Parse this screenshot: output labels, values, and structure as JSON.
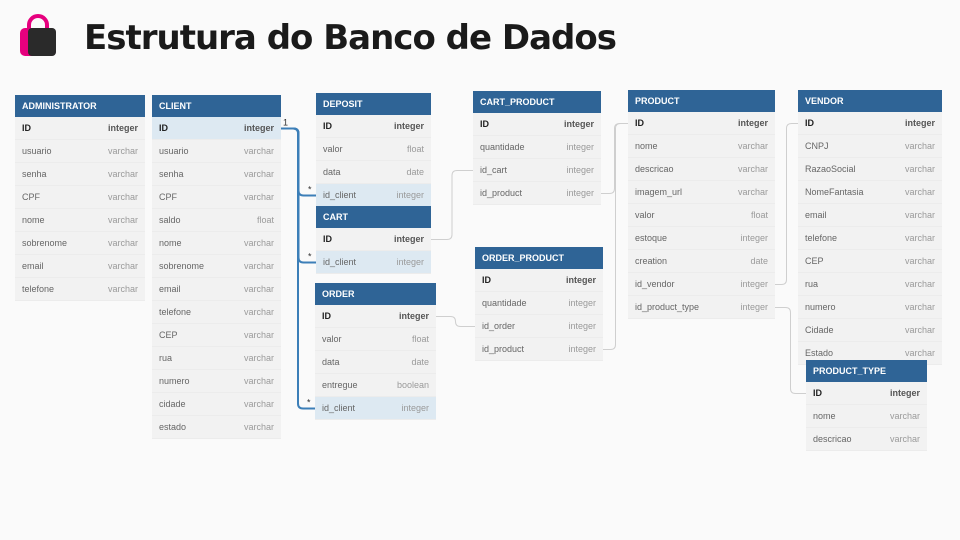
{
  "title": "Estrutura do Banco de Dados",
  "colors": {
    "header": "#2f6496",
    "highlight": "#dde9f2",
    "logo_magenta": "#e6007e",
    "relation_blue": "#3c7fb8"
  },
  "icons": {
    "logo": "shopping-bag-icon"
  },
  "tables": {
    "administrator": {
      "name": "ADMINISTRATOR",
      "fields": [
        {
          "name": "ID",
          "type": "integer"
        },
        {
          "name": "usuario",
          "type": "varchar"
        },
        {
          "name": "senha",
          "type": "varchar"
        },
        {
          "name": "CPF",
          "type": "varchar"
        },
        {
          "name": "nome",
          "type": "varchar"
        },
        {
          "name": "sobrenome",
          "type": "varchar"
        },
        {
          "name": "email",
          "type": "varchar"
        },
        {
          "name": "telefone",
          "type": "varchar"
        }
      ]
    },
    "client": {
      "name": "CLIENT",
      "fields": [
        {
          "name": "ID",
          "type": "integer"
        },
        {
          "name": "usuario",
          "type": "varchar"
        },
        {
          "name": "senha",
          "type": "varchar"
        },
        {
          "name": "CPF",
          "type": "varchar"
        },
        {
          "name": "saldo",
          "type": "float"
        },
        {
          "name": "nome",
          "type": "varchar"
        },
        {
          "name": "sobrenome",
          "type": "varchar"
        },
        {
          "name": "email",
          "type": "varchar"
        },
        {
          "name": "telefone",
          "type": "varchar"
        },
        {
          "name": "CEP",
          "type": "varchar"
        },
        {
          "name": "rua",
          "type": "varchar"
        },
        {
          "name": "numero",
          "type": "varchar"
        },
        {
          "name": "cidade",
          "type": "varchar"
        },
        {
          "name": "estado",
          "type": "varchar"
        }
      ]
    },
    "deposit": {
      "name": "DEPOSIT",
      "fields": [
        {
          "name": "ID",
          "type": "integer"
        },
        {
          "name": "valor",
          "type": "float"
        },
        {
          "name": "data",
          "type": "date"
        },
        {
          "name": "id_client",
          "type": "integer"
        }
      ]
    },
    "cart": {
      "name": "CART",
      "fields": [
        {
          "name": "ID",
          "type": "integer"
        },
        {
          "name": "id_client",
          "type": "integer"
        }
      ]
    },
    "order": {
      "name": "ORDER",
      "fields": [
        {
          "name": "ID",
          "type": "integer"
        },
        {
          "name": "valor",
          "type": "float"
        },
        {
          "name": "data",
          "type": "date"
        },
        {
          "name": "entregue",
          "type": "boolean"
        },
        {
          "name": "id_client",
          "type": "integer"
        }
      ]
    },
    "cart_product": {
      "name": "CART_PRODUCT",
      "fields": [
        {
          "name": "ID",
          "type": "integer"
        },
        {
          "name": "quantidade",
          "type": "integer"
        },
        {
          "name": "id_cart",
          "type": "integer"
        },
        {
          "name": "id_product",
          "type": "integer"
        }
      ]
    },
    "order_product": {
      "name": "ORDER_PRODUCT",
      "fields": [
        {
          "name": "ID",
          "type": "integer"
        },
        {
          "name": "quantidade",
          "type": "integer"
        },
        {
          "name": "id_order",
          "type": "integer"
        },
        {
          "name": "id_product",
          "type": "integer"
        }
      ]
    },
    "product": {
      "name": "PRODUCT",
      "fields": [
        {
          "name": "ID",
          "type": "integer"
        },
        {
          "name": "nome",
          "type": "varchar"
        },
        {
          "name": "descricao",
          "type": "varchar"
        },
        {
          "name": "imagem_url",
          "type": "varchar"
        },
        {
          "name": "valor",
          "type": "float"
        },
        {
          "name": "estoque",
          "type": "integer"
        },
        {
          "name": "creation",
          "type": "date"
        },
        {
          "name": "id_vendor",
          "type": "integer"
        },
        {
          "name": "id_product_type",
          "type": "integer"
        }
      ]
    },
    "vendor": {
      "name": "VENDOR",
      "fields": [
        {
          "name": "ID",
          "type": "integer"
        },
        {
          "name": "CNPJ",
          "type": "varchar"
        },
        {
          "name": "RazaoSocial",
          "type": "varchar"
        },
        {
          "name": "NomeFantasia",
          "type": "varchar"
        },
        {
          "name": "email",
          "type": "varchar"
        },
        {
          "name": "telefone",
          "type": "varchar"
        },
        {
          "name": "CEP",
          "type": "varchar"
        },
        {
          "name": "rua",
          "type": "varchar"
        },
        {
          "name": "numero",
          "type": "varchar"
        },
        {
          "name": "Cidade",
          "type": "varchar"
        },
        {
          "name": "Estado",
          "type": "varchar"
        }
      ]
    },
    "product_type": {
      "name": "PRODUCT_TYPE",
      "fields": [
        {
          "name": "ID",
          "type": "integer"
        },
        {
          "name": "nome",
          "type": "varchar"
        },
        {
          "name": "descricao",
          "type": "varchar"
        }
      ]
    }
  },
  "relations": [
    {
      "from": "deposit.id_client",
      "to": "client.ID",
      "from_card": "*",
      "to_card": "1",
      "highlighted": true
    },
    {
      "from": "cart.id_client",
      "to": "client.ID",
      "from_card": "*",
      "to_card": "1",
      "highlighted": true
    },
    {
      "from": "order.id_client",
      "to": "client.ID",
      "from_card": "*",
      "to_card": "1",
      "highlighted": true
    },
    {
      "from": "cart_product.id_cart",
      "to": "cart.ID",
      "highlighted": false
    },
    {
      "from": "cart_product.id_product",
      "to": "product.ID",
      "highlighted": false
    },
    {
      "from": "order_product.id_order",
      "to": "order.ID",
      "highlighted": false
    },
    {
      "from": "order_product.id_product",
      "to": "product.ID",
      "highlighted": false
    },
    {
      "from": "product.id_vendor",
      "to": "vendor.ID",
      "highlighted": false
    },
    {
      "from": "product.id_product_type",
      "to": "product_type.ID",
      "highlighted": false
    }
  ]
}
